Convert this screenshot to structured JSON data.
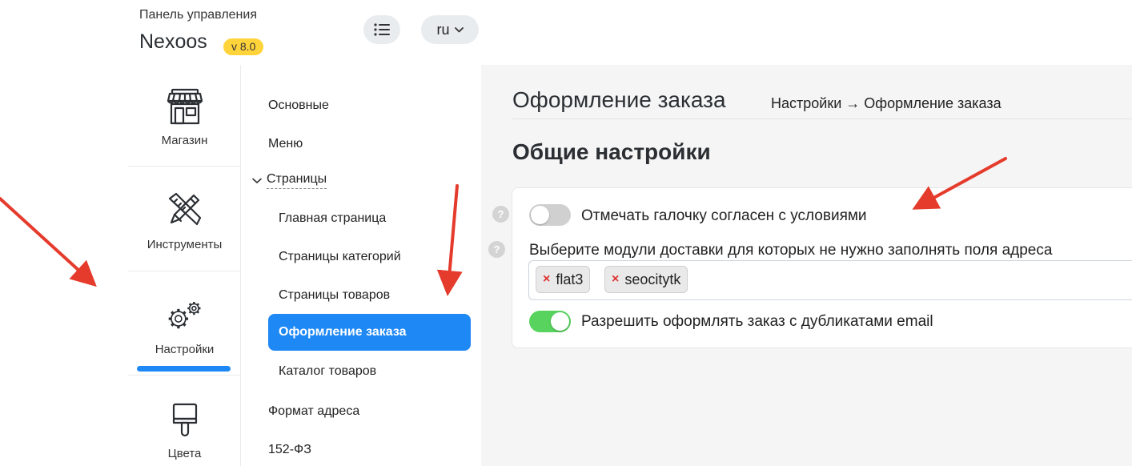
{
  "header": {
    "caption": "Панель управления",
    "app_name": "Nexoos",
    "version": "v 8.0",
    "lang": "ru"
  },
  "icon_sidebar": {
    "items": [
      {
        "label": "Магазин",
        "icon": "store-icon"
      },
      {
        "label": "Инструменты",
        "icon": "tools-icon"
      },
      {
        "label": "Настройки",
        "icon": "gears-icon",
        "active": true
      },
      {
        "label": "Цвета",
        "icon": "paintbrush-icon"
      }
    ]
  },
  "submenu": {
    "items": [
      {
        "label": "Основные"
      },
      {
        "label": "Меню"
      },
      {
        "label": "Страницы"
      },
      {
        "label": "Главная страница"
      },
      {
        "label": "Страницы категорий"
      },
      {
        "label": "Страницы товаров"
      },
      {
        "label": "Оформление заказа"
      },
      {
        "label": "Каталог товаров"
      },
      {
        "label": "Формат адреса"
      },
      {
        "label": "152-ФЗ"
      }
    ]
  },
  "main": {
    "page_title": "Оформление заказа",
    "breadcrumb": "Настройки → Оформление заказа",
    "section_title": "Общие настройки",
    "settings": {
      "agree_label": "Отмечать галочку согласен с условиями",
      "agree_enabled": false,
      "delivery_label": "Выберите модули доставки для которых не нужно заполнять поля адреса",
      "delivery_tags": [
        "flat3",
        "seocitytk"
      ],
      "duplicate_label": "Разрешить оформлять заказ с дубликатами email",
      "duplicate_enabled": true,
      "help_glyph": "?",
      "remove_glyph": "×"
    }
  },
  "colors": {
    "accent": "#1e88f5",
    "toggle_on": "#57d35e",
    "toggle_off": "#d0d0d0",
    "badge": "#ffd43b",
    "annotation_arrow": "#e53b2c"
  }
}
